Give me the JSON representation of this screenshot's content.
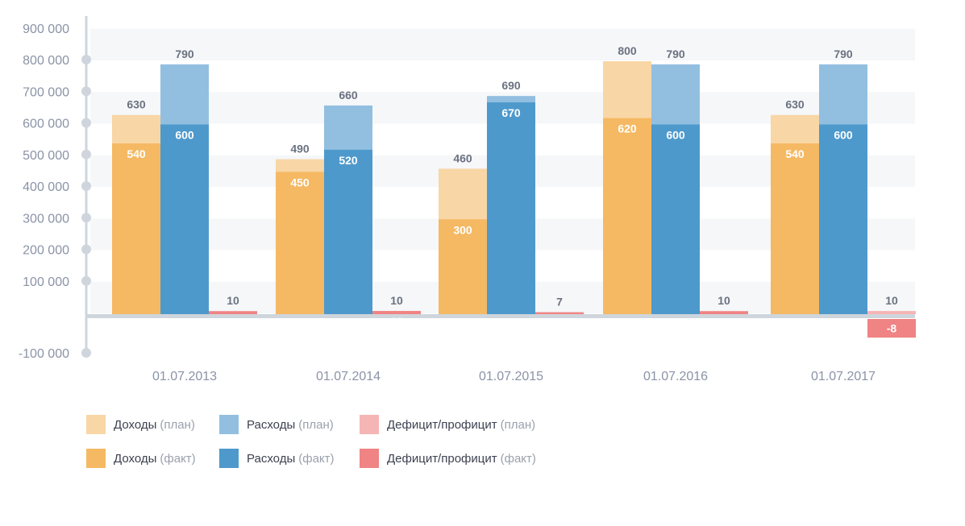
{
  "chart_data": {
    "type": "bar",
    "categories": [
      "01.07.2013",
      "01.07.2014",
      "01.07.2015",
      "01.07.2016",
      "01.07.2017"
    ],
    "y_ticks": [
      "900 000",
      "800 000",
      "700 000",
      "600 000",
      "500 000",
      "400 000",
      "300 000",
      "200 000",
      "100 000",
      "-100 000"
    ],
    "ylim": [
      -120000,
      920000
    ],
    "grid": "alternating horizontal bands",
    "legend_position": "bottom-left",
    "groups": [
      {
        "name": "Доходы",
        "plan": [
          630,
          490,
          460,
          800,
          630
        ],
        "fact": [
          540,
          450,
          300,
          620,
          540
        ],
        "plan_color": "#f8d6a5",
        "fact_color": "#f5b963"
      },
      {
        "name": "Расходы",
        "plan": [
          790,
          660,
          690,
          790,
          790
        ],
        "fact": [
          600,
          520,
          670,
          600,
          600
        ],
        "plan_color": "#92bfe0",
        "fact_color": "#4e99cc"
      },
      {
        "name": "Дефицит/профицит",
        "plan": [
          10,
          10,
          7,
          10,
          10
        ],
        "fact": [
          9,
          10,
          5,
          9,
          -8
        ],
        "plan_color": "#f5b5b5",
        "fact_color": "#f08383"
      }
    ],
    "legend": [
      {
        "name": "Доходы",
        "kind": "(план)",
        "color": "#f8d6a5"
      },
      {
        "name": "Расходы",
        "kind": "(план)",
        "color": "#92bfe0"
      },
      {
        "name": "Дефицит/профицит",
        "kind": "(план)",
        "color": "#f5b5b5"
      },
      {
        "name": "Доходы",
        "kind": "(факт)",
        "color": "#f5b963"
      },
      {
        "name": "Расходы",
        "kind": "(факт)",
        "color": "#4e99cc"
      },
      {
        "name": "Дефицит/профицит",
        "kind": "(факт)",
        "color": "#f08383"
      }
    ],
    "axis_color": "#cfd5dc",
    "band_color": "#f5f7f9"
  }
}
